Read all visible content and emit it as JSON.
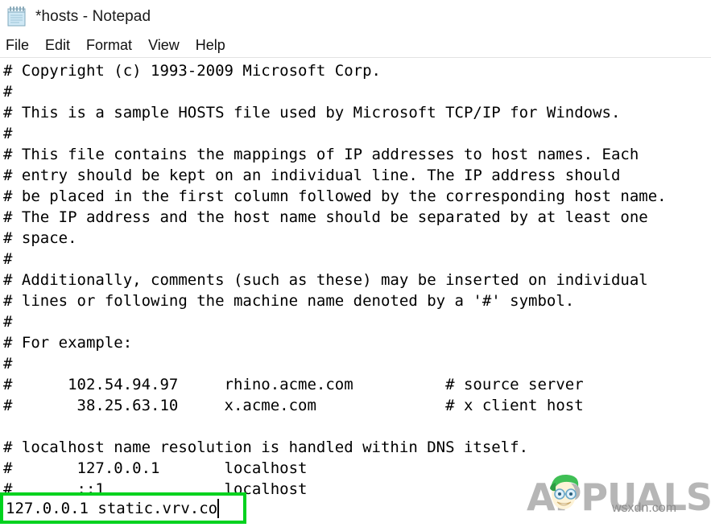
{
  "window": {
    "title": "*hosts - Notepad",
    "icon": "notepad-icon"
  },
  "menu": {
    "items": [
      {
        "label": "File"
      },
      {
        "label": "Edit"
      },
      {
        "label": "Format"
      },
      {
        "label": "View"
      },
      {
        "label": "Help"
      }
    ]
  },
  "editor": {
    "content": "# Copyright (c) 1993-2009 Microsoft Corp.\n#\n# This is a sample HOSTS file used by Microsoft TCP/IP for Windows.\n#\n# This file contains the mappings of IP addresses to host names. Each\n# entry should be kept on an individual line. The IP address should\n# be placed in the first column followed by the corresponding host name.\n# The IP address and the host name should be separated by at least one\n# space.\n#\n# Additionally, comments (such as these) may be inserted on individual\n# lines or following the machine name denoted by a '#' symbol.\n#\n# For example:\n#\n#      102.54.94.97     rhino.acme.com          # source server\n#       38.25.63.10     x.acme.com              # x client host\n\n# localhost name resolution is handled within DNS itself.\n#       127.0.0.1       localhost\n#       ::1             localhost",
    "lines": [
      "# Copyright (c) 1993-2009 Microsoft Corp.",
      "#",
      "# This is a sample HOSTS file used by Microsoft TCP/IP for Windows.",
      "#",
      "# This file contains the mappings of IP addresses to host names. Each",
      "# entry should be kept on an individual line. The IP address should",
      "# be placed in the first column followed by the corresponding host name.",
      "# The IP address and the host name should be separated by at least one",
      "# space.",
      "#",
      "# Additionally, comments (such as these) may be inserted on individual",
      "# lines or following the machine name denoted by a '#' symbol.",
      "#",
      "# For example:",
      "#",
      "#      102.54.94.97     rhino.acme.com          # source server",
      "#       38.25.63.10     x.acme.com              # x client host",
      "",
      "# localhost name resolution is handled within DNS itself.",
      "#       127.0.0.1       localhost",
      "#       ::1             localhost"
    ]
  },
  "highlight": {
    "entry_value": "127.0.0.1 static.vrv.co",
    "border_color": "#00d21e",
    "has_caret": true
  },
  "watermark": {
    "logo_text": "APPUALS",
    "source_text": "wsxdn.com",
    "color": "#9b9b9b"
  }
}
